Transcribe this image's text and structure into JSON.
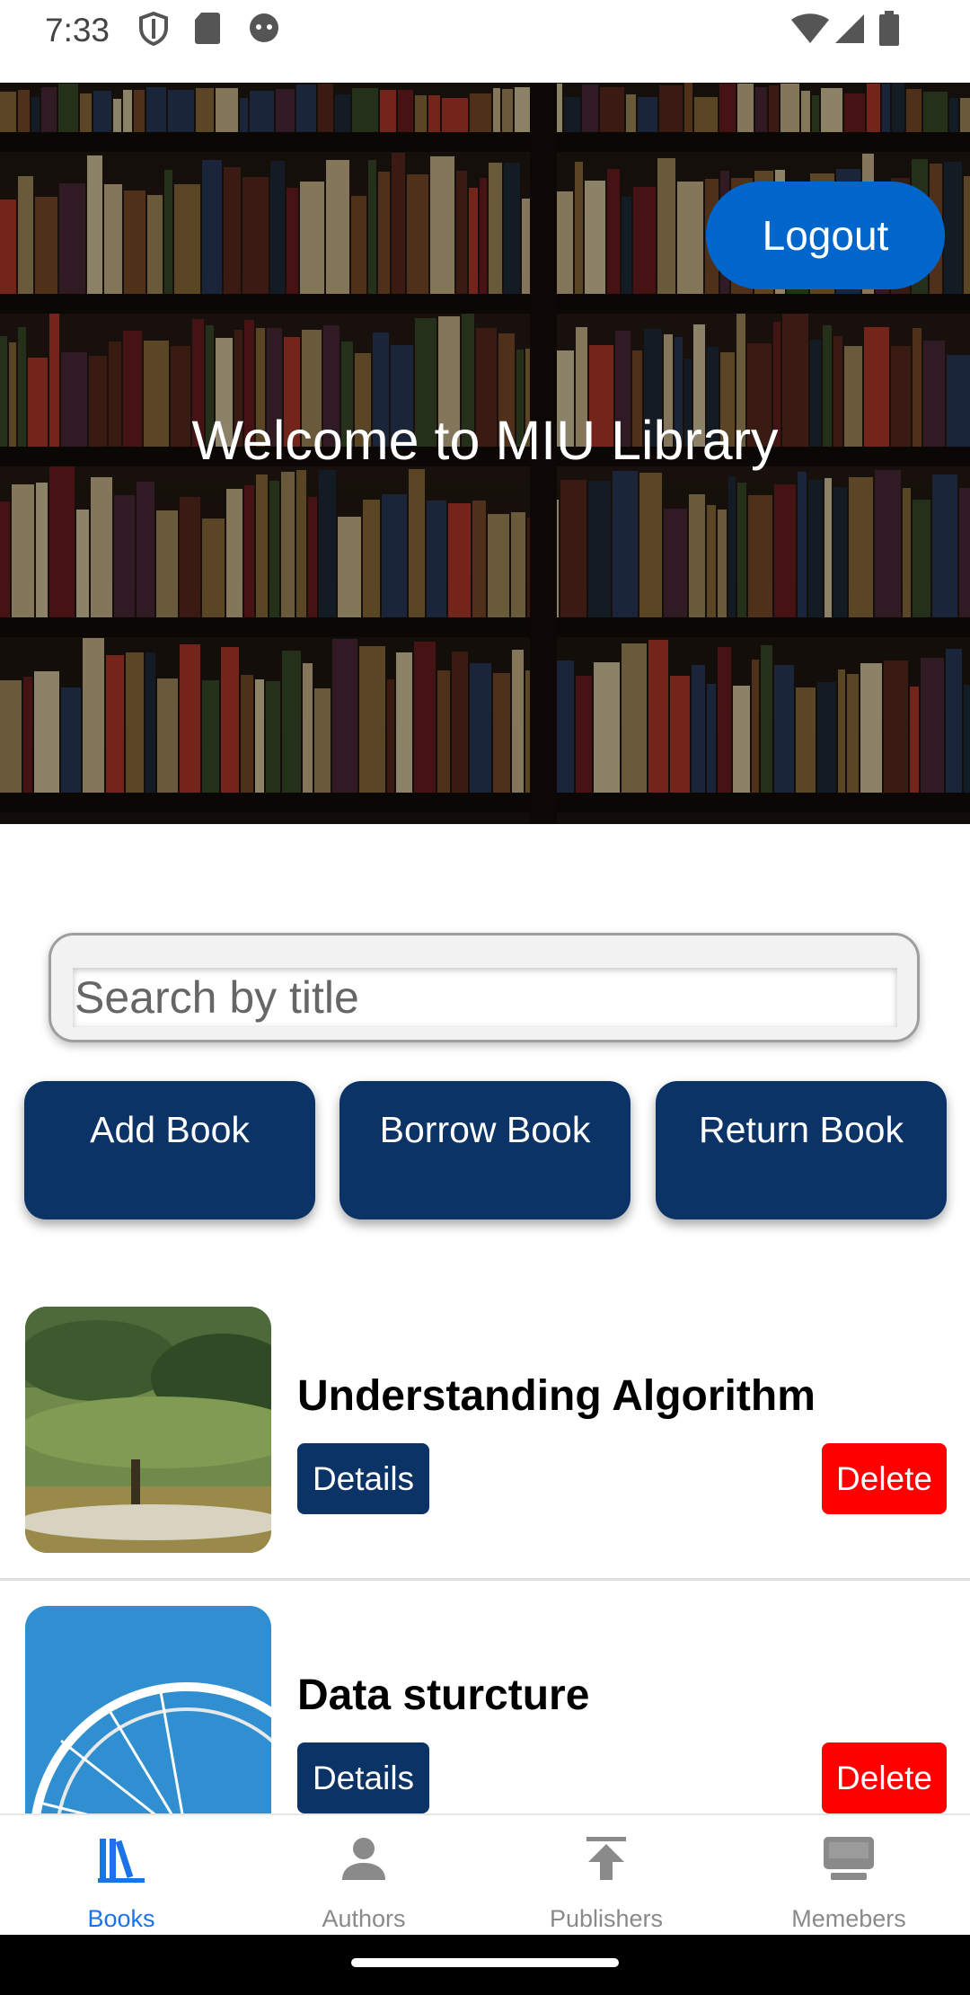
{
  "status_bar": {
    "time": "7:33"
  },
  "hero": {
    "title": "Welcome to MIU Library",
    "logout_label": "Logout"
  },
  "search": {
    "placeholder": "Search by title",
    "value": ""
  },
  "actions": {
    "add_book": "Add Book",
    "borrow_book": "Borrow Book",
    "return_book": "Return Book"
  },
  "books": [
    {
      "title": "Understanding Algorithm",
      "details_label": "Details",
      "delete_label": "Delete"
    },
    {
      "title": "Data sturcture",
      "details_label": "Details",
      "delete_label": "Delete"
    }
  ],
  "nav": {
    "items": [
      {
        "label": "Books",
        "icon": "books-icon",
        "active": true
      },
      {
        "label": "Authors",
        "icon": "person-icon",
        "active": false
      },
      {
        "label": "Publishers",
        "icon": "upload-icon",
        "active": false
      },
      {
        "label": "Memebers",
        "icon": "members-icon",
        "active": false
      }
    ]
  },
  "colors": {
    "primary_dark": "#0b3366",
    "logout_blue": "#0066cc",
    "delete_red": "#ff0000",
    "nav_active": "#1a73e8"
  }
}
